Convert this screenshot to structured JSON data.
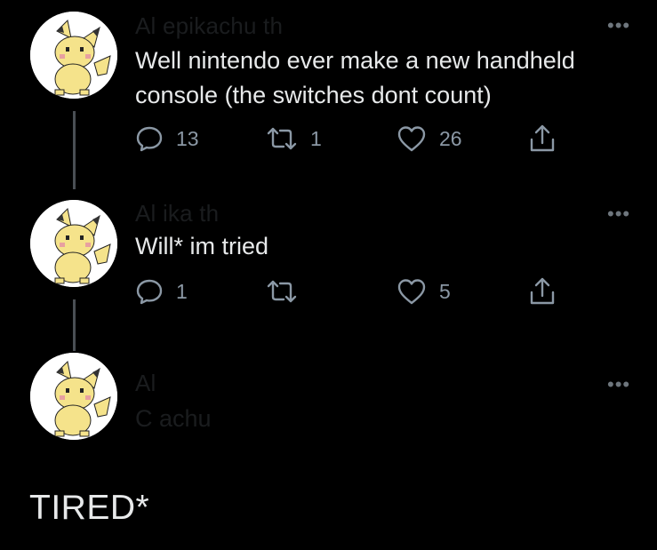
{
  "tweets": [
    {
      "author_line": "Al                          epikachu th",
      "more_label": "•••",
      "text_lines": [
        "Well nintendo ever make a new handheld",
        "console (the switches dont count)"
      ],
      "replies": "13",
      "retweets": "1",
      "likes": "26"
    },
    {
      "author_line": "Al                    ika          th",
      "more_label": "•••",
      "text_lines": [
        "Will* im tried"
      ],
      "replies": "1",
      "retweets": "",
      "likes": "5"
    },
    {
      "author_line": "Al",
      "author_sub": "C              achu",
      "more_label": "•••"
    }
  ],
  "bottom_text": "TIRED*",
  "icons": {
    "reply": "reply-icon",
    "retweet": "retweet-icon",
    "like": "heart-icon",
    "share": "share-icon",
    "more": "more-icon"
  },
  "colors": {
    "background": "#000000",
    "text": "#e7e9ea",
    "icon": "#8b98a5",
    "thread_line": "#4a4f54",
    "pikachu_yellow": "#f5e38b"
  }
}
